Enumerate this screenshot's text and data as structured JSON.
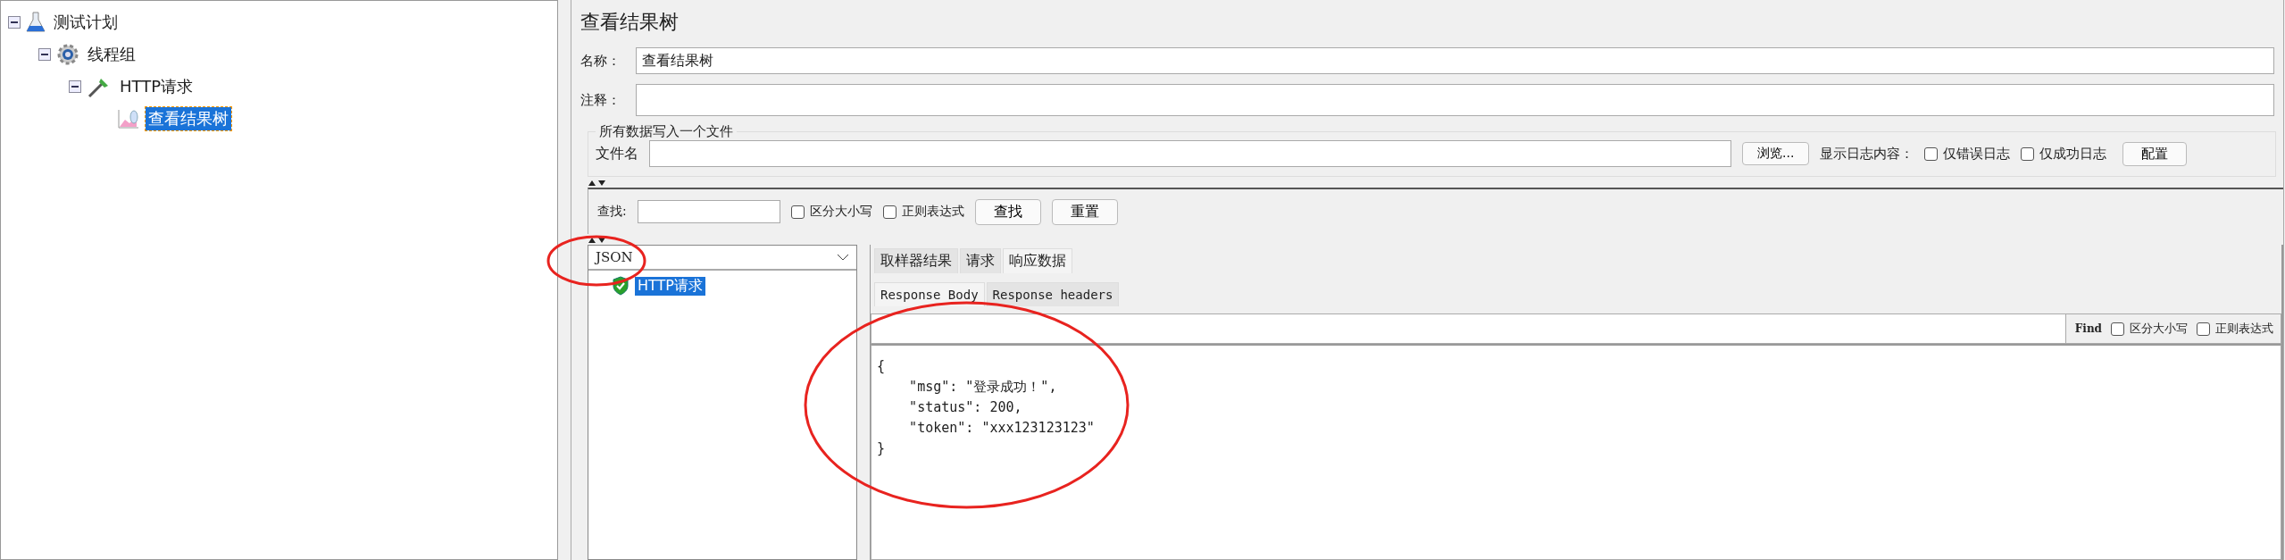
{
  "tree": [
    {
      "label": "测试计划",
      "kind": "flask",
      "expanded": true,
      "selected": false,
      "children": [
        {
          "label": "线程组",
          "kind": "gear",
          "expanded": true,
          "selected": false,
          "children": [
            {
              "label": "HTTP请求",
              "kind": "dropper",
              "expanded": true,
              "selected": false,
              "children": [
                {
                  "label": "查看结果树",
                  "kind": "chart",
                  "selected": true
                }
              ]
            }
          ]
        }
      ]
    }
  ],
  "panel": {
    "title": "查看结果树",
    "name_label": "名称：",
    "name_value": "查看结果树",
    "comment_label": "注释：",
    "file_group": {
      "legend": "所有数据写入一个文件",
      "filename_label": "文件名",
      "browse_button": "浏览...",
      "log_label": "显示日志内容：",
      "options": [
        {
          "label": "仅错误日志",
          "checked": false
        },
        {
          "label": "仅成功日志",
          "checked": false
        }
      ],
      "config_button": "配置"
    }
  },
  "search": {
    "label": "查找:",
    "options": [
      {
        "label": "区分大小写",
        "checked": false
      },
      {
        "label": "正则表达式",
        "checked": false
      }
    ],
    "buttons": [
      "查找",
      "重置"
    ]
  },
  "renderer": {
    "value": "JSON"
  },
  "results": [
    {
      "label": "HTTP请求",
      "passed": true,
      "selected": true
    }
  ],
  "tabs": [
    {
      "label": "取样器结果",
      "selected": false
    },
    {
      "label": "请求",
      "selected": false
    },
    {
      "label": "响应数据",
      "selected": true
    }
  ],
  "subtabs": [
    {
      "label": "Response Body",
      "selected": true
    },
    {
      "label": "Response headers",
      "selected": false
    }
  ],
  "body_find": {
    "label": "Find",
    "options": [
      {
        "label": "区分大小写",
        "checked": false
      },
      {
        "label": "正则表达式",
        "checked": false
      }
    ]
  },
  "body_lines": [
    "{",
    "    \"msg\": \"登录成功！\",",
    "    \"status\": 200,",
    "    \"token\": \"xxx123123123\"",
    "}"
  ],
  "annotations": [
    {
      "kind": "ellipse",
      "color": "#e8231f"
    },
    {
      "kind": "ellipse",
      "color": "#e8231f"
    }
  ]
}
